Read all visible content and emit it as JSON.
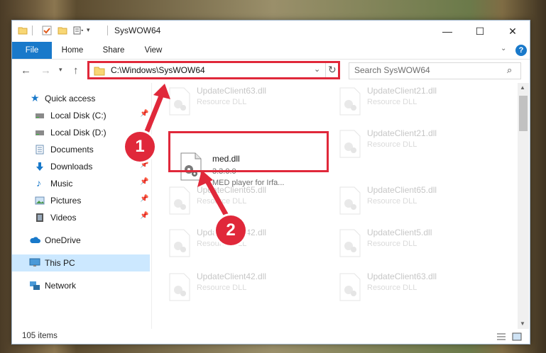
{
  "window": {
    "title": "SysWOW64"
  },
  "ribbon": {
    "tabs": [
      "File",
      "Home",
      "Share",
      "View"
    ]
  },
  "address": {
    "path": "C:\\Windows\\SysWOW64"
  },
  "search": {
    "placeholder": "Search SysWOW64"
  },
  "nav": {
    "items": [
      {
        "label": "Quick access",
        "icon": "star-icon"
      },
      {
        "label": "Local Disk (C:)",
        "icon": "drive-icon"
      },
      {
        "label": "Local Disk (D:)",
        "icon": "drive-icon"
      },
      {
        "label": "Documents",
        "icon": "documents-icon"
      },
      {
        "label": "Downloads",
        "icon": "download-arrow-icon"
      },
      {
        "label": "Music",
        "icon": "music-note-icon"
      },
      {
        "label": "Pictures",
        "icon": "pictures-icon"
      },
      {
        "label": "Videos",
        "icon": "film-icon"
      },
      {
        "label": "OneDrive",
        "icon": "cloud-icon"
      },
      {
        "label": "This PC",
        "icon": "monitor-icon"
      },
      {
        "label": "Network",
        "icon": "network-icon"
      }
    ]
  },
  "files": [
    {
      "name": "UpdateClient63.dll",
      "type": "Resource DLL"
    },
    {
      "name": "UpdateClient21.dll",
      "type": "Resource DLL"
    },
    {
      "name": "med.dll",
      "version": "3.3.0.0",
      "description": "MED player for Irfa..."
    },
    {
      "name": "UpdateClient21.dll",
      "type": "Resource DLL"
    },
    {
      "name": "UpdateClient65.dll",
      "type": "Resource DLL"
    },
    {
      "name": "UpdateClient65.dll",
      "type": "Resource DLL"
    },
    {
      "name": "UpdateClient42.dll",
      "type": "Resource DLL"
    },
    {
      "name": "UpdateClient5.dll",
      "type": "Resource DLL"
    },
    {
      "name": "UpdateClient42.dll",
      "type": "Resource DLL"
    },
    {
      "name": "UpdateClient63.dll",
      "type": "Resource DLL"
    }
  ],
  "status": {
    "item_count": "105 items"
  },
  "annotations": {
    "step1": "1",
    "step2": "2",
    "color": "#e0283a"
  }
}
